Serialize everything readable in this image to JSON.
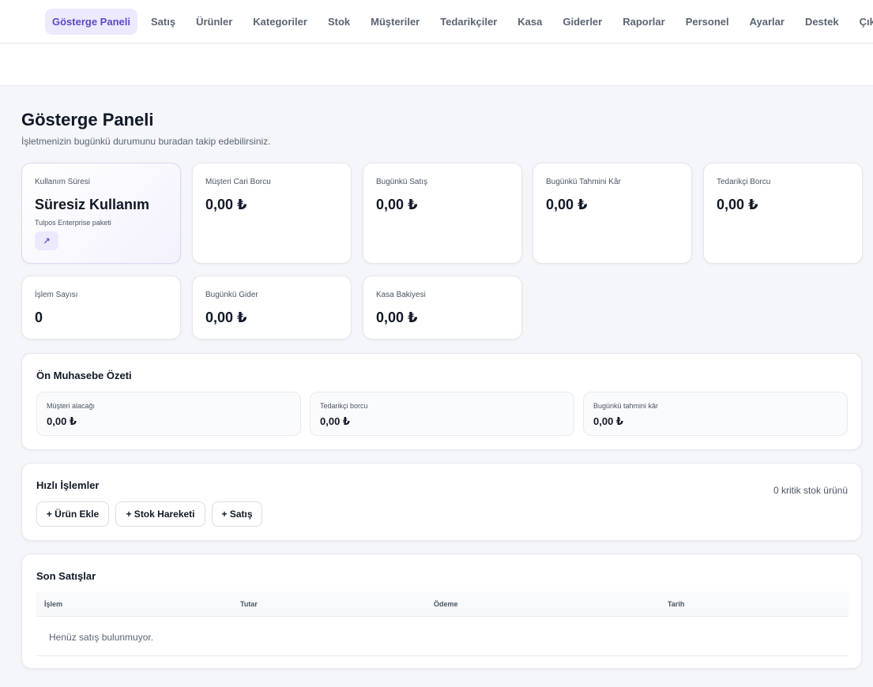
{
  "nav": {
    "items": [
      {
        "label": "Gösterge Paneli",
        "active": true
      },
      {
        "label": "Satış"
      },
      {
        "label": "Ürünler"
      },
      {
        "label": "Kategoriler"
      },
      {
        "label": "Stok"
      },
      {
        "label": "Müşteriler"
      },
      {
        "label": "Tedarikçiler"
      },
      {
        "label": "Kasa"
      },
      {
        "label": "Giderler"
      },
      {
        "label": "Raporlar"
      },
      {
        "label": "Personel"
      },
      {
        "label": "Ayarlar"
      },
      {
        "label": "Destek"
      },
      {
        "label": "Çıkış Yap"
      }
    ],
    "accent_color": "#5b4bc4"
  },
  "page": {
    "title": "Gösterge Paneli",
    "subtitle": "İşletmenizin bugünkü durumunu buradan takip edebilirsiniz."
  },
  "usage": {
    "label": "Kullanım Süresi",
    "value": "Süresiz Kullanım",
    "package": "Tulpos Enterprise paketi",
    "icon": "arrow-up-right-icon",
    "icon_glyph": "↗"
  },
  "stats": [
    {
      "label": "Müşteri Cari Borcu",
      "value": "0,00 ₺"
    },
    {
      "label": "Bugünkü Satış",
      "value": "0,00 ₺"
    },
    {
      "label": "Bugünkü Tahmini Kâr",
      "value": "0,00 ₺"
    },
    {
      "label": "Tedarikçi Borcu",
      "value": "0,00 ₺"
    },
    {
      "label": "İşlem Sayısı",
      "value": "0"
    },
    {
      "label": "Bugünkü Gider",
      "value": "0,00 ₺"
    },
    {
      "label": "Kasa Bakiyesi",
      "value": "0,00 ₺"
    }
  ],
  "accounting": {
    "title": "Ön Muhasebe Özeti",
    "items": [
      {
        "label": "Müşteri alacağı",
        "value": "0,00 ₺"
      },
      {
        "label": "Tedarikçi borcu",
        "value": "0,00 ₺"
      },
      {
        "label": "Bugünkü tahmini kâr",
        "value": "0,00 ₺"
      }
    ]
  },
  "quick": {
    "title": "Hızlı İşlemler",
    "critical_stock": "0 kritik stok ürünü",
    "buttons": [
      "+ Ürün Ekle",
      "+ Stok Hareketi",
      "+ Satış"
    ]
  },
  "sales": {
    "title": "Son Satışlar",
    "columns": [
      "İşlem",
      "Tutar",
      "Ödeme",
      "Tarih"
    ],
    "empty": "Henüz satış bulunmuyor."
  }
}
